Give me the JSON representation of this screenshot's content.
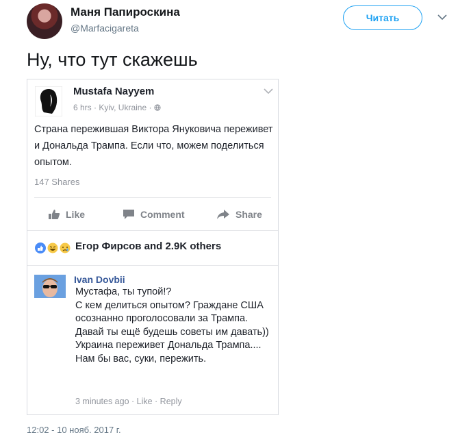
{
  "tweet": {
    "author_name": "Маня Папироскина",
    "author_handle": "@Marfacigareta",
    "follow_label": "Читать",
    "text": "Ну, что тут скажешь",
    "timestamp_peek": "12:02 - 10 нояб. 2017 г."
  },
  "fb_post": {
    "author": "Mustafa Nayyem",
    "meta": "6 hrs · Kyiv, Ukraine · ",
    "text": "Страна пережившая Виктора Януковича переживет и Дональда Трампа. Если что, можем поделиться опытом.",
    "shares": "147 Shares",
    "actions": {
      "like": "Like",
      "comment": "Comment",
      "share": "Share"
    },
    "reactions_text": "Егор Фирсов and 2.9K others"
  },
  "comment": {
    "author": "Ivan Dovbii",
    "text": "Мустафа, ты тупой!?\nС кем делиться опытом? Граждане США осознанно проголосовали за Трампа. Давай ты ещё будешь советы им давать))\nУкраина переживет Дональда Трампа....\nНам бы вас, суки, пережить.",
    "meta": "3 minutes ago · Like · Reply"
  },
  "colors": {
    "twitter_blue": "#1da1f2",
    "fb_link": "#365899",
    "muted": "#90949c"
  }
}
